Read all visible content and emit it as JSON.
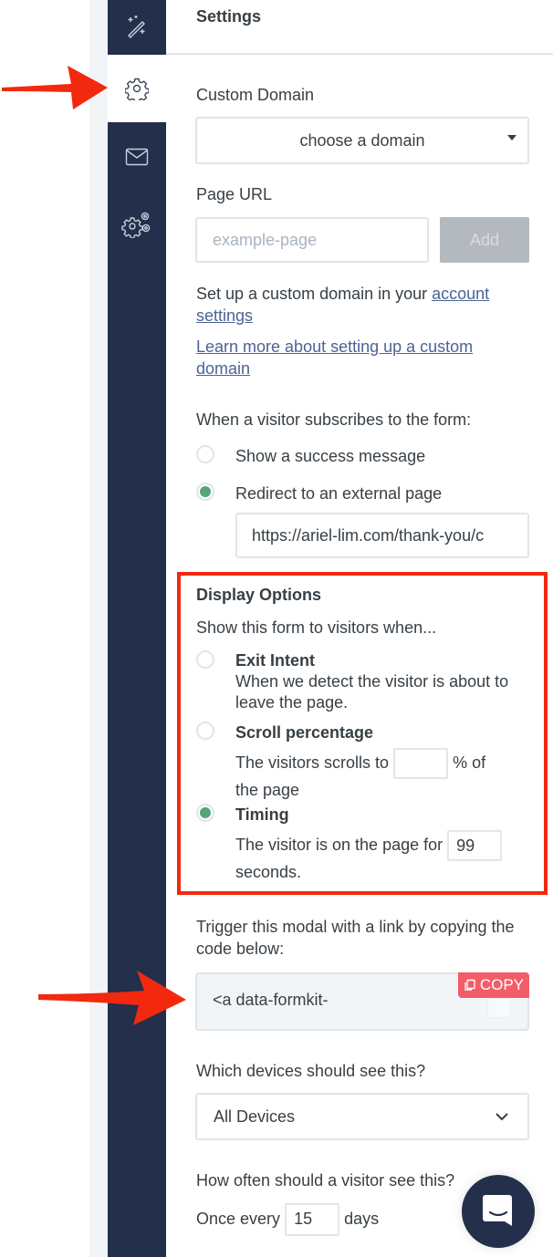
{
  "sidebar": {
    "items": [
      {
        "icon": "magic-wand-icon",
        "active": false
      },
      {
        "icon": "gear-icon",
        "active": true
      },
      {
        "icon": "envelope-icon",
        "active": false
      },
      {
        "icon": "advanced-settings-icon",
        "active": false
      }
    ]
  },
  "header": {
    "title": "Settings"
  },
  "custom_domain": {
    "label": "Custom Domain",
    "selected": "choose a domain"
  },
  "page_url": {
    "label": "Page URL",
    "placeholder": "example-page",
    "value": "",
    "add_button": "Add"
  },
  "domain_help": {
    "text": "Set up a custom domain in your ",
    "link1": "account settings",
    "link2": "Learn more about setting up a custom domain"
  },
  "subscribe_action": {
    "label": "When a visitor subscribes to the form:",
    "options": [
      {
        "label": "Show a success message",
        "checked": false
      },
      {
        "label": "Redirect to an external page",
        "checked": true
      }
    ],
    "redirect_url": "https://ariel-lim.com/thank-you/c"
  },
  "display_options": {
    "title": "Display Options",
    "subtitle": "Show this form to visitors when...",
    "exit_intent": {
      "title": "Exit Intent",
      "description": "When we detect the visitor is about to leave the page.",
      "checked": false
    },
    "scroll": {
      "title": "Scroll percentage",
      "text_before": "The visitors scrolls to",
      "value": "",
      "text_after": "% of",
      "text_line2": "the page",
      "checked": false
    },
    "timing": {
      "title": "Timing",
      "text_before": "The visitor is on the page for",
      "value": "99",
      "text_after": "seconds.",
      "checked": true
    }
  },
  "trigger": {
    "label": "Trigger this modal with a link by copying the code below:",
    "code": "<a data-formkit-",
    "copy_button": "COPY"
  },
  "devices": {
    "label": "Which devices should see this?",
    "selected": "All Devices"
  },
  "frequency": {
    "label": "How often should a visitor see this?",
    "text_before": "Once every",
    "value": "15",
    "text_after": "days"
  },
  "colors": {
    "sidebar": "#232f4b",
    "accent_green": "#55a57b",
    "copy_red": "#f35d68",
    "annotation_red": "#f2290f",
    "link": "#4b6395"
  }
}
